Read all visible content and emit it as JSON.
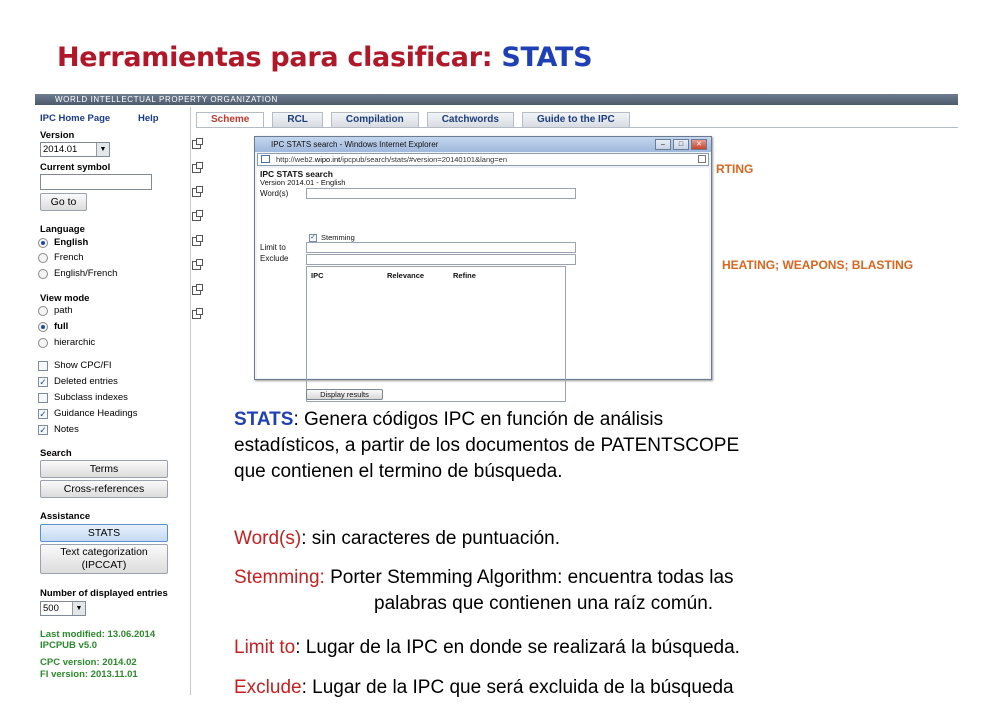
{
  "slide": {
    "title_main": "Herramientas para clasificar:",
    "title_accent": "STATS"
  },
  "wipo_bar": {
    "text": "WORLD INTELLECTUAL PROPERTY ORGANIZATION"
  },
  "sidebar": {
    "home_link": "IPC Home Page",
    "help_link": "Help",
    "version_label": "Version",
    "version_value": "2014.01",
    "current_symbol_label": "Current symbol",
    "current_symbol_value": "",
    "goto_button": "Go to",
    "language_label": "Language",
    "languages": [
      "English",
      "French",
      "English/French"
    ],
    "view_mode_label": "View mode",
    "view_modes": [
      "path",
      "full",
      "hierarchic"
    ],
    "checks": [
      {
        "label": "Show CPC/FI",
        "checked": false
      },
      {
        "label": "Deleted entries",
        "checked": true
      },
      {
        "label": "Subclass indexes",
        "checked": false
      },
      {
        "label": "Guidance Headings",
        "checked": true
      },
      {
        "label": "Notes",
        "checked": true
      }
    ],
    "search_label": "Search",
    "terms_button": "Terms",
    "crossref_button": "Cross-references",
    "assistance_label": "Assistance",
    "stats_button": "STATS",
    "textcat_button_line1": "Text categorization",
    "textcat_button_line2": "(IPCCAT)",
    "num_entries_label": "Number of displayed entries",
    "num_entries_value": "500",
    "last_modified": "Last modified: 13.06.2014",
    "ipcpub": "IPCPUB v5.0",
    "cpc_version": "CPC version: 2014.02",
    "fi_version": "FI version: 2013.11.01"
  },
  "tabs": [
    "Scheme",
    "RCL",
    "Compilation",
    "Catchwords",
    "Guide to the IPC"
  ],
  "background_text": {
    "heading1": "RTING",
    "heading2": "HEATING; WEAPONS; BLASTING"
  },
  "popup": {
    "window_title": "IPC STATS search - Windows Internet Explorer",
    "url_prefix": "http://web2.",
    "url_domain": "wipo.int",
    "url_rest": "/ipcpub/search/stats/#version=20140101&lang=en",
    "heading": "IPC STATS search",
    "version": "Version 2014.01 - English",
    "words_label": "Word(s)",
    "stemming_label": "Stemming",
    "limit_label": "Limit to",
    "exclude_label": "Exclude",
    "col_ipc": "IPC",
    "col_relevance": "Relevance",
    "col_refine": "Refine",
    "display_button": "Display results"
  },
  "description": {
    "stats_kw": "STATS",
    "stats_text_l1": ":  Genera códigos IPC en función de análisis",
    "stats_text_l2": "estadísticos, a partir de los documentos de PATENTSCOPE",
    "stats_text_l3": "que contienen el termino de búsqueda.",
    "words_kw": "Word(s)",
    "words_text": ": sin caracteres de puntuación.",
    "stemming_kw": "Stemming:",
    "stemming_text_l1": " Porter Stemming Algorithm:  encuentra todas las",
    "stemming_text_l2": "palabras que contienen una raíz común.",
    "limit_kw": "Limit to",
    "limit_text": ":  Lugar de la IPC en donde se realizará la búsqueda.",
    "exclude_kw": "Exclude",
    "exclude_text": ": Lugar de la IPC que será excluida de la búsqueda"
  }
}
